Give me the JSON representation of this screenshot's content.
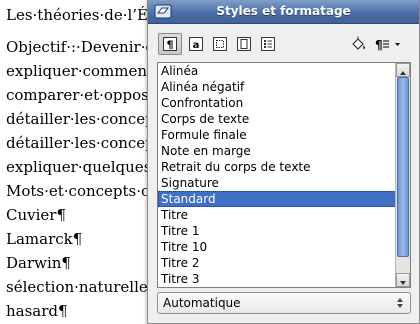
{
  "document": {
    "lines": [
      "Les·théories·de·l’Év",
      "Objectif·:·Devenir·c",
      "expliquer·comment·",
      "comparer·et·opposer",
      "détailler·les·concept",
      "détailler·les·concept",
      "expliquer·quelques·i",
      "Mots·et·concepts·cle",
      "Cuvier¶",
      "Lamarck¶",
      "Darwin¶",
      "sélection·naturelle¶",
      "hasard¶"
    ]
  },
  "panel": {
    "title": "Styles et formatage",
    "toolbar": {
      "buttons": [
        {
          "name": "paragraph-styles",
          "icon": "paragraph-styles-icon",
          "active": true
        },
        {
          "name": "character-styles",
          "icon": "character-styles-icon",
          "active": false
        },
        {
          "name": "frame-styles",
          "icon": "frame-styles-icon",
          "active": false
        },
        {
          "name": "page-styles",
          "icon": "page-styles-icon",
          "active": false
        },
        {
          "name": "list-styles",
          "icon": "list-styles-icon",
          "active": false
        }
      ],
      "right_buttons": [
        {
          "name": "fill-format-mode",
          "icon": "paint-bucket-icon"
        },
        {
          "name": "new-style-from-selection",
          "icon": "new-style-icon"
        }
      ]
    },
    "styles": [
      "Alinéa",
      "Alinéa négatif",
      "Confrontation",
      "Corps de texte",
      "Formule finale",
      "Note en marge",
      "Retrait du corps de texte",
      "Signature",
      "Standard",
      "Titre",
      "Titre 1",
      "Titre 10",
      "Titre 2",
      "Titre 3"
    ],
    "selected_style": "Standard",
    "filter": {
      "value": "Automatique"
    }
  }
}
